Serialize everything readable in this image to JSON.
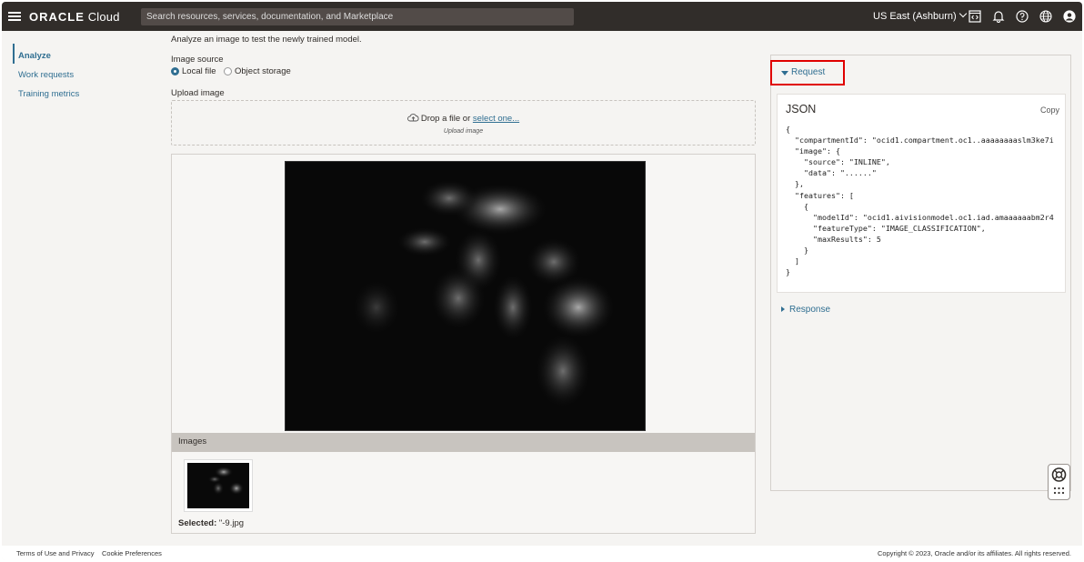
{
  "header": {
    "brand_bold": "ORACLE",
    "brand_rest": " Cloud",
    "search_placeholder": "Search resources, services, documentation, and Marketplace",
    "region": "US East (Ashburn)"
  },
  "sidebar": {
    "items": [
      {
        "label": "Analyze",
        "active": true
      },
      {
        "label": "Work requests",
        "active": false
      },
      {
        "label": "Training metrics",
        "active": false
      }
    ]
  },
  "main": {
    "intro": "Analyze an image to test the newly trained model.",
    "image_source_label": "Image source",
    "options": [
      {
        "label": "Local file",
        "selected": true
      },
      {
        "label": "Object storage",
        "selected": false
      }
    ],
    "upload_label": "Upload image",
    "drop_text": "Drop a file or ",
    "drop_link": "select one...",
    "drop_sub": "Upload image",
    "images_label": "Images",
    "selected_label": "Selected:",
    "selected_file": " \"-9.jpg"
  },
  "request": {
    "toggle_label": "Request",
    "json_title": "JSON",
    "copy_label": "Copy",
    "code": "{\n  \"compartmentId\": \"ocid1.compartment.oc1..aaaaaaaaslm3ke7i\n  \"image\": {\n    \"source\": \"INLINE\",\n    \"data\": \"......\"\n  },\n  \"features\": [\n    {\n      \"modelId\": \"ocid1.aivisionmodel.oc1.iad.amaaaaaabm2r4\n      \"featureType\": \"IMAGE_CLASSIFICATION\",\n      \"maxResults\": 5\n    }\n  ]\n}"
  },
  "response": {
    "toggle_label": "Response"
  },
  "footer": {
    "terms": "Terms of Use and Privacy",
    "cookies": "Cookie Preferences",
    "copyright": "Copyright © 2023, Oracle and/or its affiliates. All rights reserved."
  },
  "colors": {
    "header_bg": "#312d2a",
    "link": "#2f6e91",
    "highlight": "#e00000"
  }
}
